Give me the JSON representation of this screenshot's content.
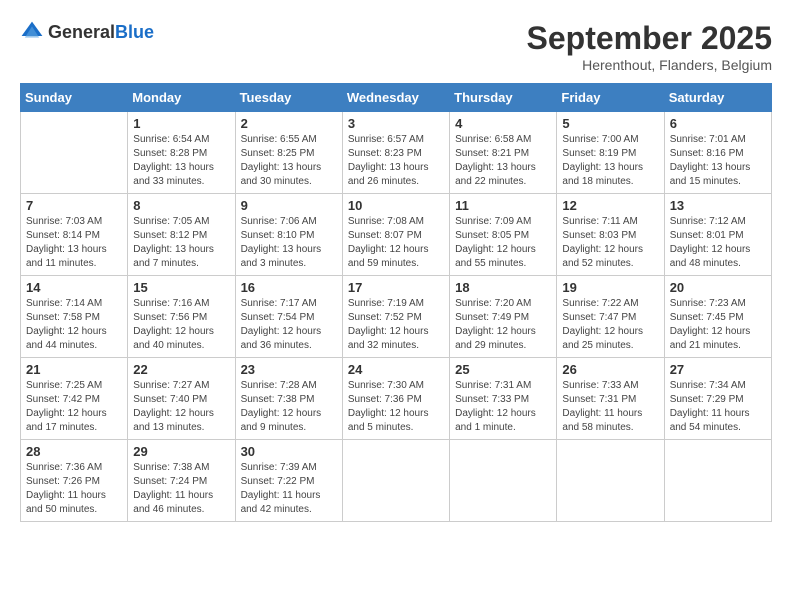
{
  "logo": {
    "text_general": "General",
    "text_blue": "Blue"
  },
  "title": {
    "month": "September 2025",
    "location": "Herenthout, Flanders, Belgium"
  },
  "headers": [
    "Sunday",
    "Monday",
    "Tuesday",
    "Wednesday",
    "Thursday",
    "Friday",
    "Saturday"
  ],
  "weeks": [
    [
      {
        "day": "",
        "info": ""
      },
      {
        "day": "1",
        "info": "Sunrise: 6:54 AM\nSunset: 8:28 PM\nDaylight: 13 hours\nand 33 minutes."
      },
      {
        "day": "2",
        "info": "Sunrise: 6:55 AM\nSunset: 8:25 PM\nDaylight: 13 hours\nand 30 minutes."
      },
      {
        "day": "3",
        "info": "Sunrise: 6:57 AM\nSunset: 8:23 PM\nDaylight: 13 hours\nand 26 minutes."
      },
      {
        "day": "4",
        "info": "Sunrise: 6:58 AM\nSunset: 8:21 PM\nDaylight: 13 hours\nand 22 minutes."
      },
      {
        "day": "5",
        "info": "Sunrise: 7:00 AM\nSunset: 8:19 PM\nDaylight: 13 hours\nand 18 minutes."
      },
      {
        "day": "6",
        "info": "Sunrise: 7:01 AM\nSunset: 8:16 PM\nDaylight: 13 hours\nand 15 minutes."
      }
    ],
    [
      {
        "day": "7",
        "info": "Sunrise: 7:03 AM\nSunset: 8:14 PM\nDaylight: 13 hours\nand 11 minutes."
      },
      {
        "day": "8",
        "info": "Sunrise: 7:05 AM\nSunset: 8:12 PM\nDaylight: 13 hours\nand 7 minutes."
      },
      {
        "day": "9",
        "info": "Sunrise: 7:06 AM\nSunset: 8:10 PM\nDaylight: 13 hours\nand 3 minutes."
      },
      {
        "day": "10",
        "info": "Sunrise: 7:08 AM\nSunset: 8:07 PM\nDaylight: 12 hours\nand 59 minutes."
      },
      {
        "day": "11",
        "info": "Sunrise: 7:09 AM\nSunset: 8:05 PM\nDaylight: 12 hours\nand 55 minutes."
      },
      {
        "day": "12",
        "info": "Sunrise: 7:11 AM\nSunset: 8:03 PM\nDaylight: 12 hours\nand 52 minutes."
      },
      {
        "day": "13",
        "info": "Sunrise: 7:12 AM\nSunset: 8:01 PM\nDaylight: 12 hours\nand 48 minutes."
      }
    ],
    [
      {
        "day": "14",
        "info": "Sunrise: 7:14 AM\nSunset: 7:58 PM\nDaylight: 12 hours\nand 44 minutes."
      },
      {
        "day": "15",
        "info": "Sunrise: 7:16 AM\nSunset: 7:56 PM\nDaylight: 12 hours\nand 40 minutes."
      },
      {
        "day": "16",
        "info": "Sunrise: 7:17 AM\nSunset: 7:54 PM\nDaylight: 12 hours\nand 36 minutes."
      },
      {
        "day": "17",
        "info": "Sunrise: 7:19 AM\nSunset: 7:52 PM\nDaylight: 12 hours\nand 32 minutes."
      },
      {
        "day": "18",
        "info": "Sunrise: 7:20 AM\nSunset: 7:49 PM\nDaylight: 12 hours\nand 29 minutes."
      },
      {
        "day": "19",
        "info": "Sunrise: 7:22 AM\nSunset: 7:47 PM\nDaylight: 12 hours\nand 25 minutes."
      },
      {
        "day": "20",
        "info": "Sunrise: 7:23 AM\nSunset: 7:45 PM\nDaylight: 12 hours\nand 21 minutes."
      }
    ],
    [
      {
        "day": "21",
        "info": "Sunrise: 7:25 AM\nSunset: 7:42 PM\nDaylight: 12 hours\nand 17 minutes."
      },
      {
        "day": "22",
        "info": "Sunrise: 7:27 AM\nSunset: 7:40 PM\nDaylight: 12 hours\nand 13 minutes."
      },
      {
        "day": "23",
        "info": "Sunrise: 7:28 AM\nSunset: 7:38 PM\nDaylight: 12 hours\nand 9 minutes."
      },
      {
        "day": "24",
        "info": "Sunrise: 7:30 AM\nSunset: 7:36 PM\nDaylight: 12 hours\nand 5 minutes."
      },
      {
        "day": "25",
        "info": "Sunrise: 7:31 AM\nSunset: 7:33 PM\nDaylight: 12 hours\nand 1 minute."
      },
      {
        "day": "26",
        "info": "Sunrise: 7:33 AM\nSunset: 7:31 PM\nDaylight: 11 hours\nand 58 minutes."
      },
      {
        "day": "27",
        "info": "Sunrise: 7:34 AM\nSunset: 7:29 PM\nDaylight: 11 hours\nand 54 minutes."
      }
    ],
    [
      {
        "day": "28",
        "info": "Sunrise: 7:36 AM\nSunset: 7:26 PM\nDaylight: 11 hours\nand 50 minutes."
      },
      {
        "day": "29",
        "info": "Sunrise: 7:38 AM\nSunset: 7:24 PM\nDaylight: 11 hours\nand 46 minutes."
      },
      {
        "day": "30",
        "info": "Sunrise: 7:39 AM\nSunset: 7:22 PM\nDaylight: 11 hours\nand 42 minutes."
      },
      {
        "day": "",
        "info": ""
      },
      {
        "day": "",
        "info": ""
      },
      {
        "day": "",
        "info": ""
      },
      {
        "day": "",
        "info": ""
      }
    ]
  ]
}
